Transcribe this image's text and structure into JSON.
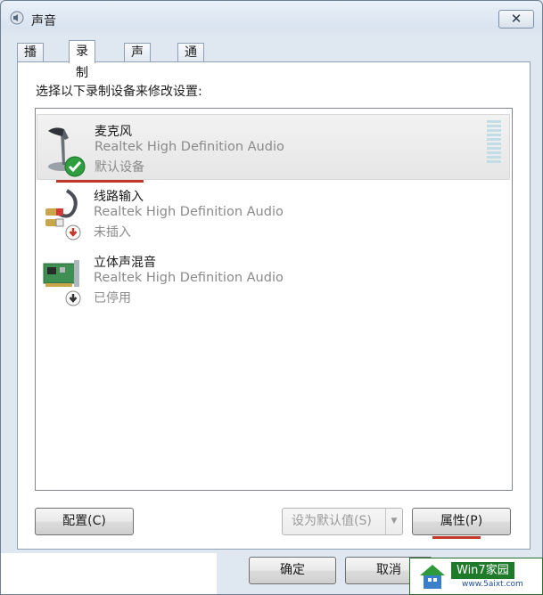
{
  "window": {
    "title": "声音",
    "close_glyph": "✕"
  },
  "tabs": [
    {
      "label": "播放",
      "active": false
    },
    {
      "label": "录制",
      "active": true
    },
    {
      "label": "声音",
      "active": false
    },
    {
      "label": "通信",
      "active": false
    }
  ],
  "panel": {
    "instruction": "选择以下录制设备来修改设置:"
  },
  "devices": [
    {
      "name": "麦克风",
      "driver": "Realtek High Definition Audio",
      "status": "默认设备",
      "icon": "microphone-icon",
      "badge": "default-check",
      "selected": true
    },
    {
      "name": "线路输入",
      "driver": "Realtek High Definition Audio",
      "status": "未插入",
      "icon": "audio-cable-icon",
      "badge": "unplugged",
      "selected": false
    },
    {
      "name": "立体声混音",
      "driver": "Realtek High Definition Audio",
      "status": "已停用",
      "icon": "sound-card-icon",
      "badge": "disabled",
      "selected": false
    }
  ],
  "buttons": {
    "configure": "配置(C)",
    "set_default": "设为默认值(S)",
    "properties": "属性(P)",
    "ok": "确定",
    "cancel": "取消"
  },
  "watermark": {
    "brand": "Win7家园",
    "url": "www.5aixt.com"
  },
  "colors": {
    "highlight": "#c0392b",
    "check_green": "#2e9e3e",
    "unplugged_red": "#c0392b"
  }
}
